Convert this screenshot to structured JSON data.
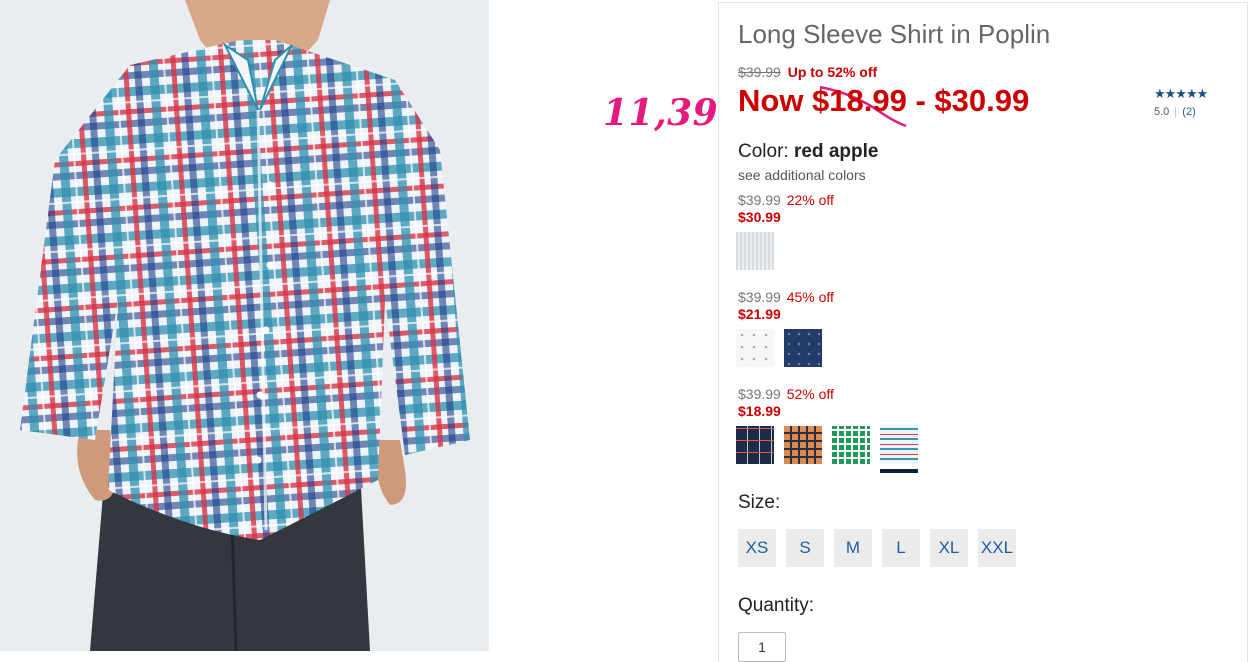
{
  "annotation": "11,39",
  "product": {
    "title": "Long Sleeve Shirt in Poplin",
    "was_price": "$39.99",
    "discount_text": "Up to 52% off",
    "now_price": "Now $18.99 - $30.99",
    "rating": {
      "stars": "★★★★★",
      "value": "5.0",
      "count": "(2)"
    }
  },
  "color": {
    "label": "Color:",
    "selected": "red apple",
    "see_more": "see additional colors"
  },
  "tiers": [
    {
      "was": "$39.99",
      "off": "22% off",
      "price": "$30.99",
      "swatches": [
        "light-gray-texture"
      ]
    },
    {
      "was": "$39.99",
      "off": "45% off",
      "price": "$21.99",
      "swatches": [
        "white-dot",
        "navy-dot"
      ]
    },
    {
      "was": "$39.99",
      "off": "52% off",
      "price": "$18.99",
      "swatches": [
        "navy-plaid",
        "orange-plaid",
        "green-plaid",
        "blue-red-plaid"
      ]
    }
  ],
  "size": {
    "label": "Size:",
    "options": [
      "XS",
      "S",
      "M",
      "L",
      "XL",
      "XXL"
    ]
  },
  "quantity": {
    "label": "Quantity:",
    "value": "1"
  },
  "colors": {
    "sale_red": "#cc0000",
    "link_blue": "#1f5fa0",
    "annotation_pink": "#e6197f",
    "navy": "#0a2240"
  }
}
